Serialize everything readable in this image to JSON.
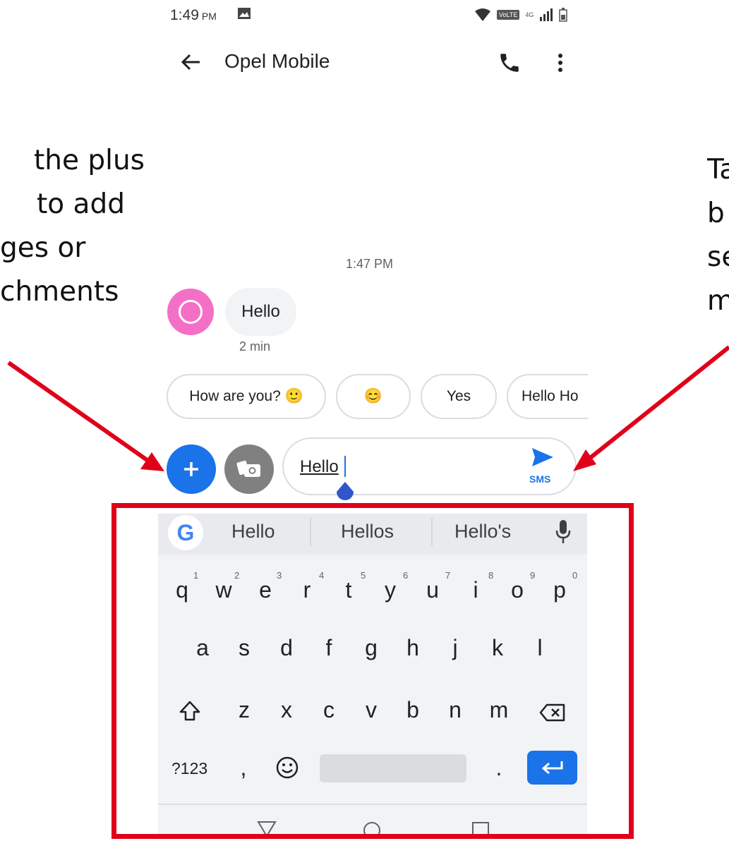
{
  "annotations": {
    "left_lines": [
      "the plus",
      "to add",
      "ges or",
      "chments"
    ],
    "right_lines": [
      "Ta",
      "b",
      "se",
      "m"
    ]
  },
  "status_bar": {
    "time": "1:49",
    "ampm": "PM",
    "network_badge": "VoLTE",
    "network_type": "4G"
  },
  "header": {
    "title": "Opel Mobile"
  },
  "conversation": {
    "timestamp": "1:47 PM",
    "messages": [
      {
        "text": "Hello",
        "meta": "2 min"
      }
    ]
  },
  "suggestions": [
    "How are you? 🙂",
    "😊",
    "Yes",
    "Hello Ho"
  ],
  "compose": {
    "text": "Hello",
    "send_label": "SMS"
  },
  "keyboard": {
    "brand_letter": "G",
    "word_suggestions": [
      "Hello",
      "Hellos",
      "Hello's"
    ],
    "row1": [
      "q",
      "w",
      "e",
      "r",
      "t",
      "y",
      "u",
      "i",
      "o",
      "p"
    ],
    "row1_numbers": [
      "1",
      "2",
      "3",
      "4",
      "5",
      "6",
      "7",
      "8",
      "9",
      "0"
    ],
    "row2": [
      "a",
      "s",
      "d",
      "f",
      "g",
      "h",
      "j",
      "k",
      "l"
    ],
    "row3": [
      "z",
      "x",
      "c",
      "v",
      "b",
      "n",
      "m"
    ],
    "symbols_key": "?123",
    "comma_key": ",",
    "period_key": "."
  },
  "colors": {
    "accent": "#1a73e8",
    "avatar": "#f46fc6",
    "annotation_red": "#e0001a"
  }
}
